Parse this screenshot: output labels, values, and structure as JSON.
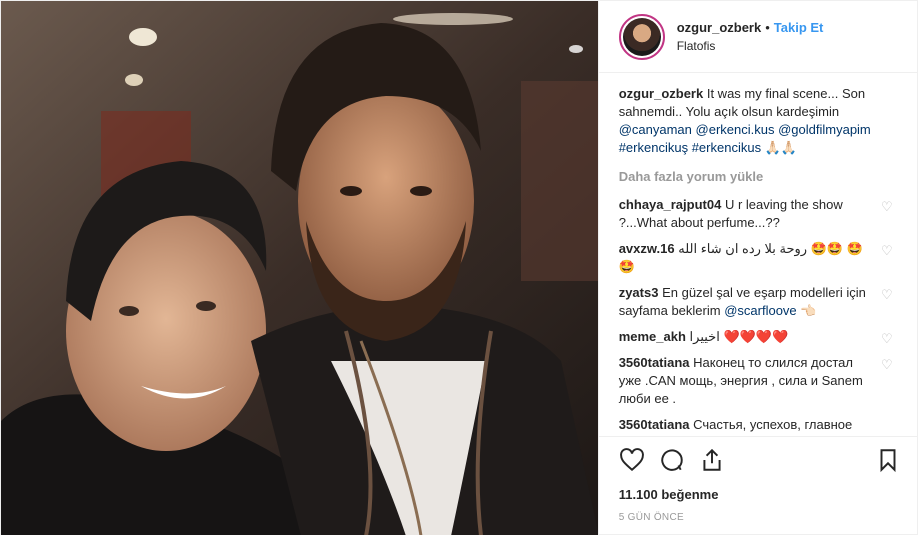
{
  "post": {
    "username": "ozgur_ozberk",
    "separator": "•",
    "follow_label": "Takip Et",
    "location": "Flatofis",
    "caption": {
      "username": "ozgur_ozberk",
      "text": "It was my final scene... Son sahnemdi.. Yolu açık olsun kardeşimin",
      "mentions": [
        "@canyaman",
        "@erkenci.kus",
        "@goldfilmyapim"
      ],
      "hashtags": [
        "#erkencikuş",
        "#erkencikus"
      ],
      "emoji": "🙏🏻🙏🏻"
    },
    "load_more_label": "Daha fazla yorum yükle",
    "comments": [
      {
        "username": "chhaya_rajput04",
        "text": "U r leaving the show ?...What about perfume...??"
      },
      {
        "username": "avxzw.16",
        "text": "روحة بلا رده ان شاء الله 🤩🤩 🤩🤩"
      },
      {
        "username": "zyats3",
        "text": "En güzel şal ve eşarp modelleri için sayfama beklerim",
        "mention": "@scarfloove",
        "emoji": "👈🏻"
      },
      {
        "username": "meme_akh",
        "text": "اخييرا ❤️❤️❤️❤️"
      },
      {
        "username": "3560tatiana",
        "text": "Наконец то слился достал уже .CAN мощь, энергия , сила и Sanem люби ее ."
      },
      {
        "username": "3560tatiana",
        "text": "Счастья, успехов, главное здоровья и всего самого наилучшего)я одна из многих.но"
      }
    ],
    "likes": "11.100 beğenme",
    "time_ago": "5 GÜN ÖNCE"
  },
  "icons": {
    "like": "heart-icon",
    "comment": "comment-icon",
    "share": "share-icon",
    "save": "bookmark-icon",
    "comment_like": "small-heart-icon"
  },
  "colors": {
    "link": "#003569",
    "follow": "#3897f0",
    "muted": "#999999",
    "story_ring": "#c13584"
  }
}
